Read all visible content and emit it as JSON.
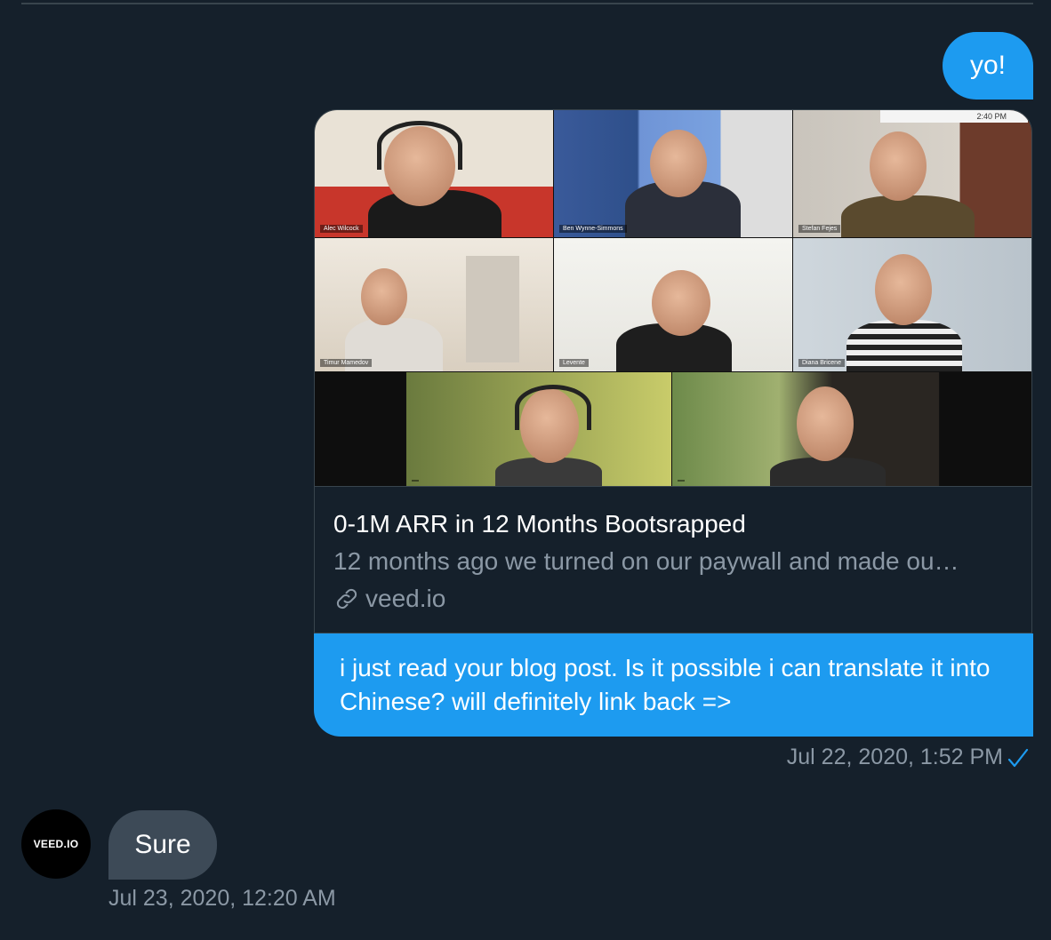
{
  "messages": {
    "sent_1": "yo!",
    "sent_2": "i just read your blog post. Is it possible i can translate it into Chinese? will definitely link back =>",
    "sent_time": "Jul 22, 2020, 1:52 PM",
    "received_1": "Sure",
    "received_time": "Jul 23, 2020, 12:20 AM"
  },
  "link_card": {
    "title": "0-1M ARR in 12 Months Bootsrapped",
    "description": "12 months ago we turned on our paywall and made ou…",
    "domain": "veed.io",
    "image": {
      "clock": "2:40 PM",
      "participants": [
        "Alec Wilcock",
        "Ben Wynne-Simmons",
        "Stefan Fejes",
        "Timur Mamedov",
        "Levente",
        "Diana Bricene",
        "",
        ""
      ]
    }
  },
  "contact": {
    "avatar_text": "VEED.IO"
  },
  "colors": {
    "accent": "#1d9bf0",
    "background": "#15202b",
    "received_bubble": "#3d4a57",
    "muted": "#8b98a5"
  },
  "icons": {
    "link": "link-icon",
    "read_receipt": "check-icon"
  }
}
